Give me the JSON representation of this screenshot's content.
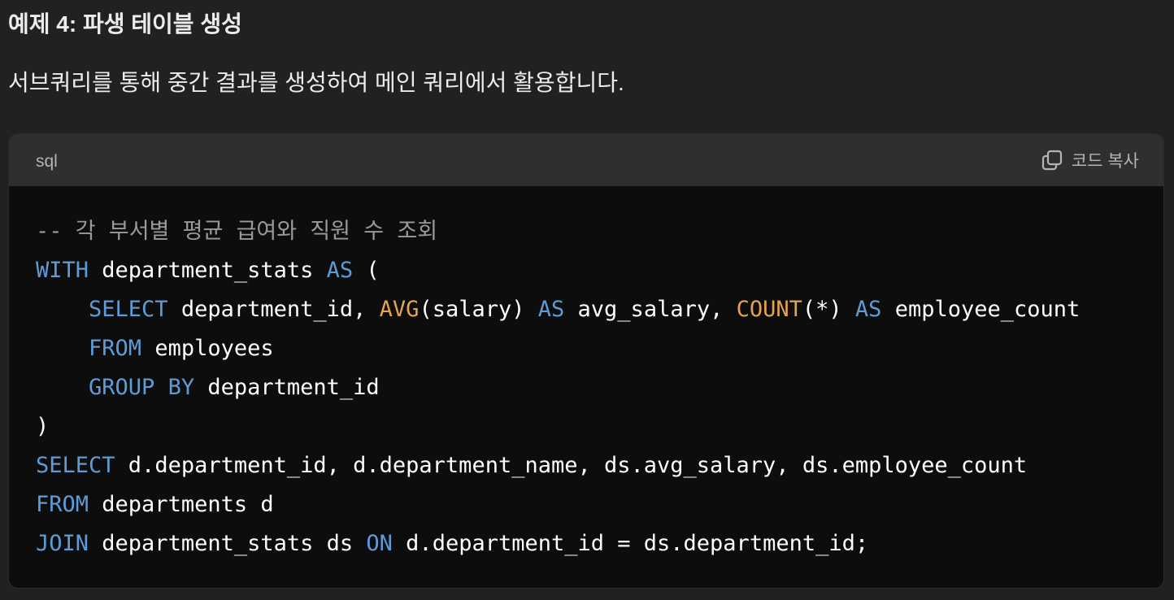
{
  "heading": "예제 4: 파생 테이블 생성",
  "description": "서브쿼리를 통해 중간 결과를 생성하여 메인 쿼리에서 활용합니다.",
  "code_block": {
    "language": "sql",
    "copy_label": "코드 복사",
    "copy_icon": "copy-icon",
    "colors": {
      "keyword": "#5d9cd6",
      "function": "#e3a34f",
      "comment": "#9a9a9a",
      "text": "#ffffff"
    },
    "lines": [
      [
        {
          "t": "cm",
          "v": "-- 각 부서별 평균 급여와 직원 수 조회"
        }
      ],
      [
        {
          "t": "kw",
          "v": "WITH"
        },
        {
          "t": "tx",
          "v": " department_stats "
        },
        {
          "t": "kw",
          "v": "AS"
        },
        {
          "t": "tx",
          "v": " ("
        }
      ],
      [
        {
          "t": "tx",
          "v": "    "
        },
        {
          "t": "kw",
          "v": "SELECT"
        },
        {
          "t": "tx",
          "v": " department_id, "
        },
        {
          "t": "fn",
          "v": "AVG"
        },
        {
          "t": "tx",
          "v": "(salary) "
        },
        {
          "t": "kw",
          "v": "AS"
        },
        {
          "t": "tx",
          "v": " avg_salary, "
        },
        {
          "t": "fn",
          "v": "COUNT"
        },
        {
          "t": "tx",
          "v": "(*) "
        },
        {
          "t": "kw",
          "v": "AS"
        },
        {
          "t": "tx",
          "v": " employee_count"
        }
      ],
      [
        {
          "t": "tx",
          "v": "    "
        },
        {
          "t": "kw",
          "v": "FROM"
        },
        {
          "t": "tx",
          "v": " employees"
        }
      ],
      [
        {
          "t": "tx",
          "v": "    "
        },
        {
          "t": "kw",
          "v": "GROUP BY"
        },
        {
          "t": "tx",
          "v": " department_id"
        }
      ],
      [
        {
          "t": "tx",
          "v": ")"
        }
      ],
      [
        {
          "t": "kw",
          "v": "SELECT"
        },
        {
          "t": "tx",
          "v": " d.department_id, d.department_name, ds.avg_salary, ds.employee_count"
        }
      ],
      [
        {
          "t": "kw",
          "v": "FROM"
        },
        {
          "t": "tx",
          "v": " departments d"
        }
      ],
      [
        {
          "t": "kw",
          "v": "JOIN"
        },
        {
          "t": "tx",
          "v": " department_stats ds "
        },
        {
          "t": "kw",
          "v": "ON"
        },
        {
          "t": "tx",
          "v": " d.department_id = ds.department_id;"
        }
      ]
    ]
  }
}
